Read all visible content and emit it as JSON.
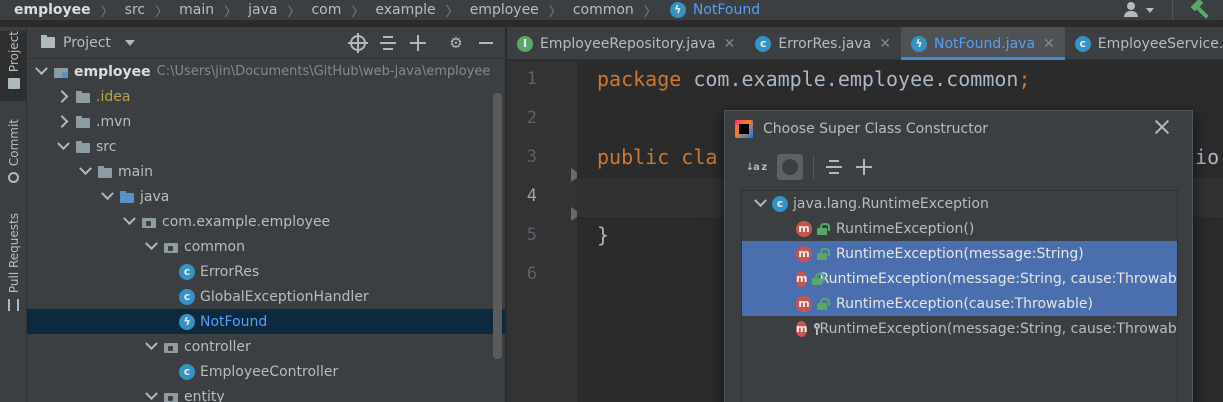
{
  "breadcrumb": [
    "employee",
    "src",
    "main",
    "java",
    "com",
    "example",
    "employee",
    "common",
    "NotFound"
  ],
  "tool_stripe": {
    "project": "Project",
    "commit": "Commit",
    "pull_requests": "Pull Requests"
  },
  "project_panel": {
    "title": "Project",
    "root_label": "employee",
    "root_path": "C:\\Users\\jin\\Documents\\GitHub\\web-java\\employee",
    "items": [
      {
        "label": ".idea",
        "icon": "folder-icon"
      },
      {
        "label": ".mvn",
        "icon": "folder-icon"
      },
      {
        "label": "src",
        "icon": "folder-icon"
      },
      {
        "label": "main",
        "icon": "folder-icon"
      },
      {
        "label": "java",
        "icon": "source-folder-icon"
      },
      {
        "label": "com.example.employee",
        "icon": "package-icon"
      },
      {
        "label": "common",
        "icon": "package-icon"
      },
      {
        "label": "ErrorRes",
        "icon": "class-icon"
      },
      {
        "label": "GlobalExceptionHandler",
        "icon": "class-icon"
      },
      {
        "label": "NotFound",
        "icon": "exception-class-icon"
      },
      {
        "label": "controller",
        "icon": "package-icon"
      },
      {
        "label": "EmployeeController",
        "icon": "class-icon"
      },
      {
        "label": "entity",
        "icon": "package-icon"
      }
    ]
  },
  "tabs": [
    {
      "label": "EmployeeRepository.java",
      "icon": "interface-icon",
      "active": false
    },
    {
      "label": "ErrorRes.java",
      "icon": "class-icon",
      "active": false
    },
    {
      "label": "NotFound.java",
      "icon": "exception-class-icon",
      "active": true
    },
    {
      "label": "EmployeeService.java",
      "icon": "class-icon",
      "active": false
    }
  ],
  "editor": {
    "line_numbers": [
      "1",
      "2",
      "3",
      "4",
      "5",
      "6"
    ],
    "current_line": "4",
    "line1_kw": "package",
    "line1_rest": " com.example.employee.common",
    "line1_semi": ";",
    "line3_kw": "public",
    "line3_partial": " cla",
    "line3_tail": "tio",
    "line5": "}"
  },
  "popup": {
    "title": "Choose Super Class Constructor",
    "toolbar": {
      "sort_label": "↓a z",
      "sort_icon": "sort-alphabetically-icon",
      "inherited_icon": "show-inherited-icon",
      "expand_icon": "expand-all-icon",
      "collapse_icon": "collapse-all-icon"
    },
    "root": "java.lang.RuntimeException",
    "constructors": [
      {
        "label": "RuntimeException()",
        "access": "public",
        "selected": false
      },
      {
        "label": "RuntimeException(message:String)",
        "access": "public",
        "selected": true
      },
      {
        "label": "RuntimeException(message:String, cause:Throwable",
        "access": "public",
        "selected": true
      },
      {
        "label": "RuntimeException(cause:Throwable)",
        "access": "public",
        "selected": true
      },
      {
        "label": "RuntimeException(message:String, cause:Throwable",
        "access": "protected",
        "selected": false
      }
    ],
    "method_badge": "m"
  },
  "colors": {
    "keyword": "#cc7832",
    "selection": "#4b6eaf",
    "tree_selection": "#0d293e",
    "link_blue": "#589df6"
  }
}
